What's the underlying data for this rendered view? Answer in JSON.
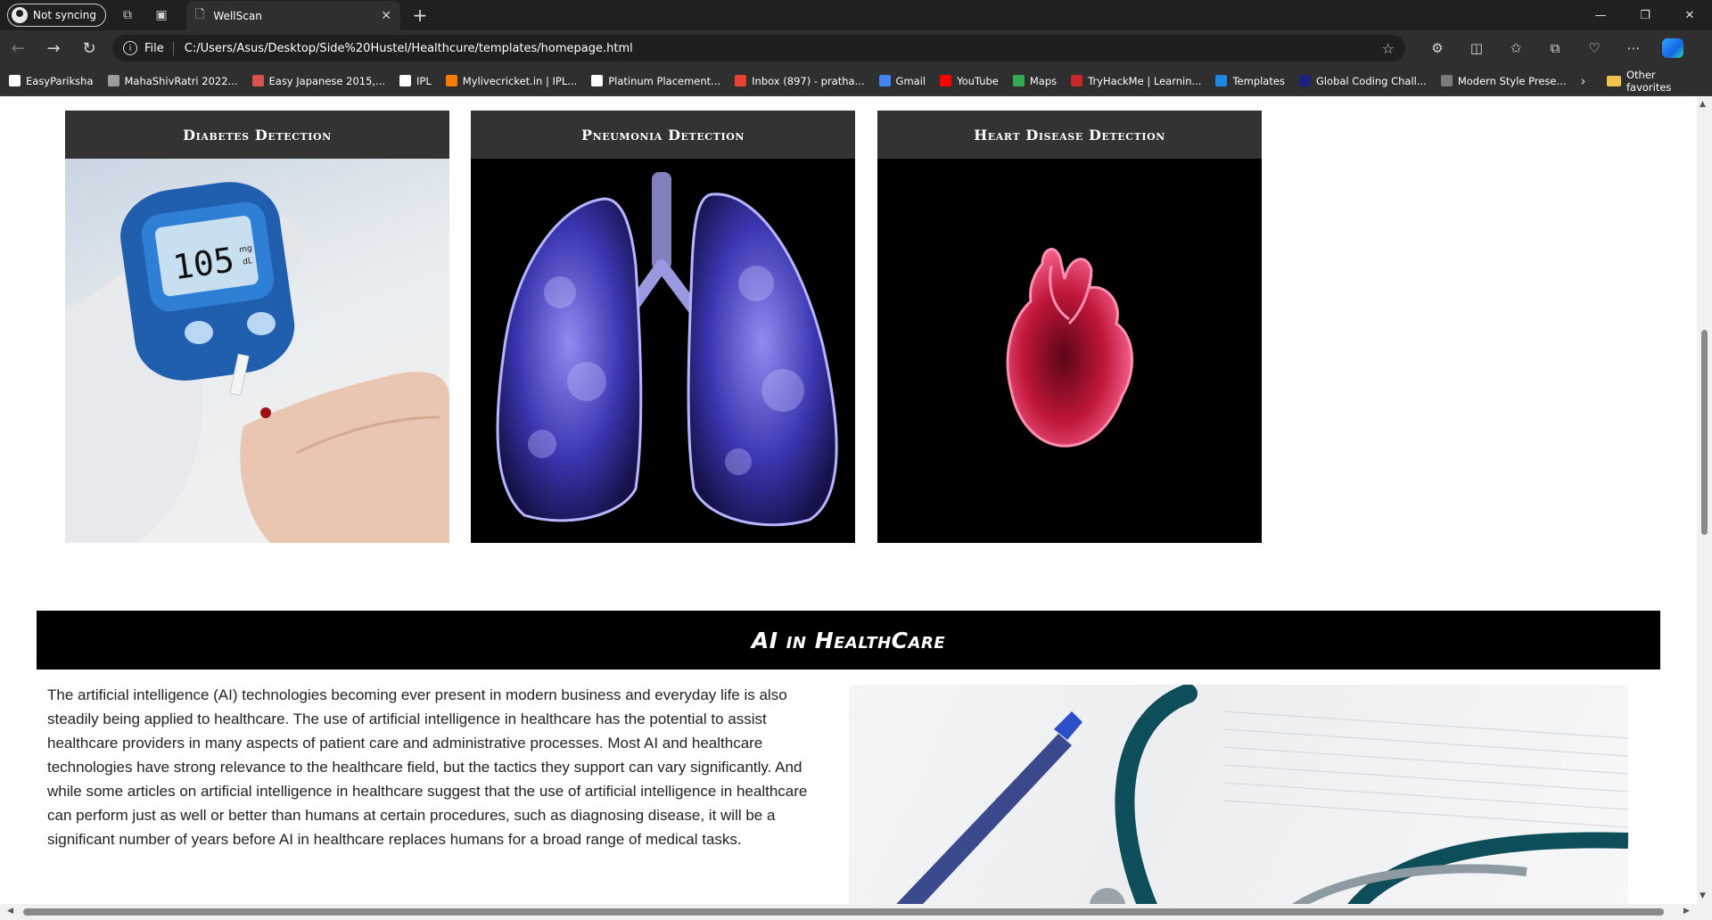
{
  "browser": {
    "profile_label": "Not syncing",
    "tab_title": "WellScan",
    "file_label": "File",
    "url": "C:/Users/Asus/Desktop/Side%20Hustel/Healthcure/templates/homepage.html",
    "bookmarks": [
      {
        "label": "EasyPariksha",
        "color": "#ffffff"
      },
      {
        "label": "MahaShivRatri 2022...",
        "color": "#9c9c9c"
      },
      {
        "label": "Easy Japanese 2015,...",
        "color": "#d9534f"
      },
      {
        "label": "IPL",
        "color": "#ffffff"
      },
      {
        "label": "Mylivecricket.in | IPL...",
        "color": "#f57c00"
      },
      {
        "label": "Platinum Placement...",
        "color": "#ffffff"
      },
      {
        "label": "Inbox (897) - pratha...",
        "color": "#ea4335"
      },
      {
        "label": "Gmail",
        "color": "#4285f4"
      },
      {
        "label": "YouTube",
        "color": "#ff0000"
      },
      {
        "label": "Maps",
        "color": "#34a853"
      },
      {
        "label": "TryHackMe | Learnin...",
        "color": "#c62828"
      },
      {
        "label": "Templates",
        "color": "#1e88e5"
      },
      {
        "label": "Global Coding Chall...",
        "color": "#1a237e"
      },
      {
        "label": "Modern Style Prese...",
        "color": "#7b7b7b"
      }
    ],
    "other_favorites": "Other favorites"
  },
  "cards": [
    {
      "title": "Diabetes Detection"
    },
    {
      "title": "Pneumonia Detection"
    },
    {
      "title": "Heart Disease Detection"
    }
  ],
  "glucose_reading": "105",
  "glucose_unit_top": "mg",
  "glucose_unit_bottom": "dL",
  "ai_section": {
    "title": "AI in HealthCare",
    "body": "The artificial intelligence (AI) technologies becoming ever present in modern business and everyday life is also steadily being applied to healthcare. The use of artificial intelligence in healthcare has the potential to assist healthcare providers in many aspects of patient care and administrative processes. Most AI and healthcare technologies have strong relevance to the healthcare field, but the tactics they support can vary significantly. And while some articles on artificial intelligence in healthcare suggest that the use of artificial intelligence in healthcare can perform just as well or better than humans at certain procedures, such as diagnosing disease, it will be a significant number of years before AI in healthcare replaces humans for a broad range of medical tasks."
  }
}
